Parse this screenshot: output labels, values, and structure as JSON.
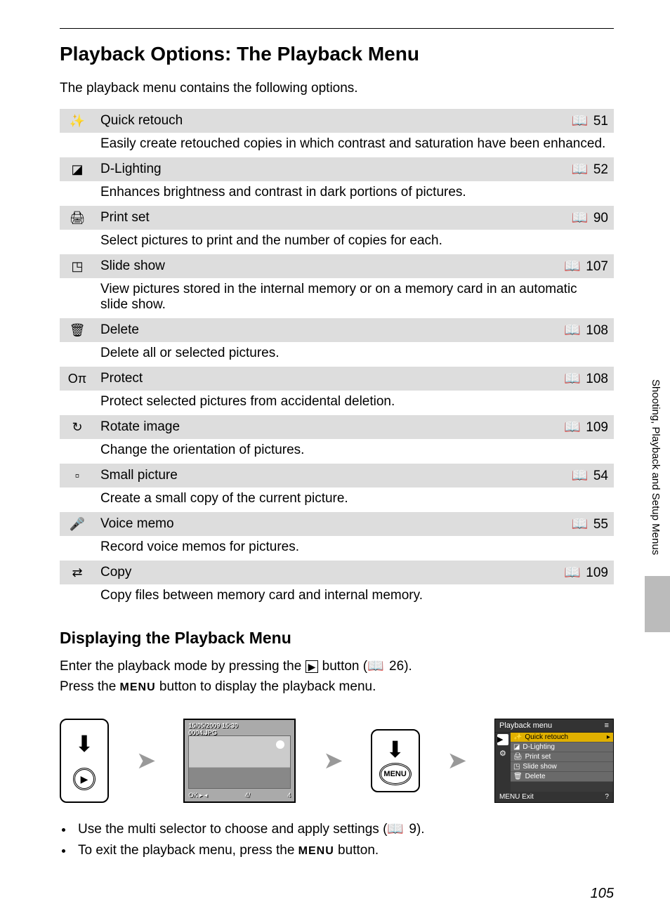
{
  "title": "Playback Options: The Playback Menu",
  "intro": "The playback menu contains the following options.",
  "options": [
    {
      "icon": "✨",
      "title": "Quick retouch",
      "page": "51",
      "desc": "Easily create retouched copies in which contrast and saturation have been enhanced."
    },
    {
      "icon": "◪",
      "title": "D-Lighting",
      "page": "52",
      "desc": "Enhances brightness and contrast in dark portions of pictures."
    },
    {
      "icon": "🖨",
      "title": "Print set",
      "page": "90",
      "desc": "Select pictures to print and the number of copies for each."
    },
    {
      "icon": "◳",
      "title": "Slide show",
      "page": "107",
      "desc": "View pictures stored in the internal memory or on a memory card in an automatic slide show."
    },
    {
      "icon": "🗑",
      "title": "Delete",
      "page": "108",
      "desc": "Delete all or selected pictures."
    },
    {
      "icon": "Oπ",
      "title": "Protect",
      "page": "108",
      "desc": "Protect selected pictures from accidental deletion."
    },
    {
      "icon": "↻",
      "title": "Rotate image",
      "page": "109",
      "desc": "Change the orientation of pictures."
    },
    {
      "icon": "▫",
      "title": "Small picture",
      "page": "54",
      "desc": "Create a small copy of the current picture."
    },
    {
      "icon": "🎤",
      "title": "Voice memo",
      "page": "55",
      "desc": "Record voice memos for pictures."
    },
    {
      "icon": "⇄",
      "title": "Copy",
      "page": "109",
      "desc": "Copy files between memory card and internal memory."
    }
  ],
  "subheading": "Displaying the Playback Menu",
  "body_line1_pre": "Enter the playback mode by pressing the ",
  "body_line1_post_a": " button (",
  "body_line1_ref": "26",
  "body_line1_post_b": ").",
  "body_line2_pre": "Press the ",
  "body_line2_mid": " button to display the playback menu.",
  "menu_label": "MENU",
  "play_symbol": "▶",
  "lcd": {
    "date": "15/05/2009 15:30",
    "file": "0004.JPG",
    "count_left": "OK ▸ ◂",
    "count_mid": "4/",
    "count_right": "4"
  },
  "menu_screen": {
    "header": "Playback menu",
    "header_icon": "≡",
    "items": [
      {
        "icon": "✨",
        "label": "Quick retouch",
        "selected": true
      },
      {
        "icon": "◪",
        "label": "D-Lighting",
        "selected": false
      },
      {
        "icon": "🖨",
        "label": "Print set",
        "selected": false
      },
      {
        "icon": "◳",
        "label": "Slide show",
        "selected": false
      },
      {
        "icon": "🗑",
        "label": "Delete",
        "selected": false
      }
    ],
    "side_play": "▶",
    "side_setup": "⚙",
    "footer_left": "MENU Exit",
    "footer_right": "?"
  },
  "bullets": {
    "b1_pre": "Use the multi selector to choose and apply settings (",
    "b1_ref": "9",
    "b1_post": ").",
    "b2_pre": "To exit the playback menu, press the ",
    "b2_post": " button."
  },
  "side_label": "Shooting, Playback and Setup Menus",
  "page_number": "105",
  "book_glyph": "📖"
}
